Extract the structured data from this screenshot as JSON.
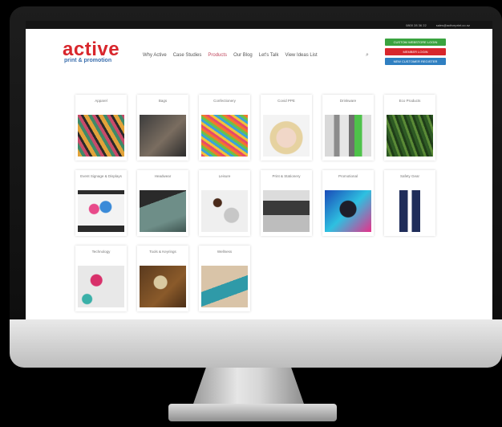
{
  "topbar": {
    "phone": "0800 28 36 22",
    "email": "sales@activeprint.co.nz"
  },
  "logo": {
    "main": "active",
    "sub": "print & promotion"
  },
  "nav": [
    "Why Active",
    "Case Studies",
    "Products",
    "Our Blog",
    "Let's Talk",
    "View Ideas List"
  ],
  "nav_active": "Products",
  "buttons": [
    {
      "label": "CUSTOM WEBSTORE LOGIN",
      "color": "#3aa33f"
    },
    {
      "label": "MEMBER LOGIN",
      "color": "#d8262c"
    },
    {
      "label": "NEW CUSTOMER REGISTER",
      "color": "#2f7fc1"
    }
  ],
  "categories": [
    "Apparel",
    "Bags",
    "Confectionery",
    "Covid PPE",
    "Drinkware",
    "Eco Products",
    "Event Signage & Displays",
    "Headwear",
    "Leisure",
    "Print & Stationery",
    "Promotional",
    "Safety Gear",
    "Technology",
    "Tools & Keyrings",
    "Wellness"
  ]
}
